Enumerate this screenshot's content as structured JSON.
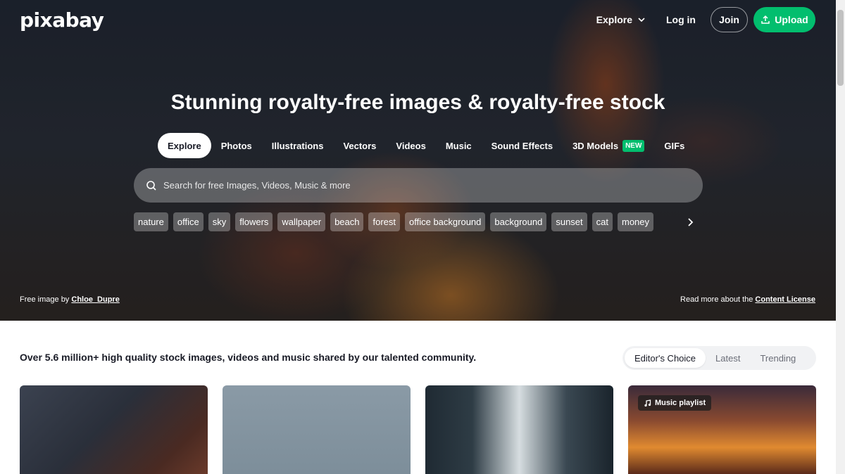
{
  "brand": {
    "logo_text": "pixabay",
    "accent_color": "#02be6e"
  },
  "topnav": {
    "explore_label": "Explore",
    "login_label": "Log in",
    "join_label": "Join",
    "upload_label": "Upload"
  },
  "hero": {
    "headline": "Stunning royalty-free images & royalty-free stock",
    "tabs": [
      {
        "label": "Explore"
      },
      {
        "label": "Photos"
      },
      {
        "label": "Illustrations"
      },
      {
        "label": "Vectors"
      },
      {
        "label": "Videos"
      },
      {
        "label": "Music"
      },
      {
        "label": "Sound Effects"
      },
      {
        "label": "3D Models",
        "badge": "NEW"
      },
      {
        "label": "GIFs"
      }
    ],
    "search_placeholder": "Search for free Images, Videos, Music & more",
    "chips": [
      "nature",
      "office",
      "sky",
      "flowers",
      "wallpaper",
      "beach",
      "forest",
      "office background",
      "background",
      "sunset",
      "cat",
      "money"
    ],
    "credit_prefix": "Free image by ",
    "credit_author": "Chloe_Dupre",
    "license_prefix": "Read more about the ",
    "license_link": "Content License"
  },
  "content": {
    "tagline": "Over 5.6 million+ high quality stock images, videos and music shared by our talented community.",
    "filters": [
      {
        "label": "Editor's Choice"
      },
      {
        "label": "Latest"
      },
      {
        "label": "Trending"
      }
    ],
    "music_badge": "Music playlist"
  },
  "icons": [
    "chevron-down-icon",
    "upload-icon",
    "search-icon",
    "chevron-right-icon",
    "music-note-icon"
  ]
}
